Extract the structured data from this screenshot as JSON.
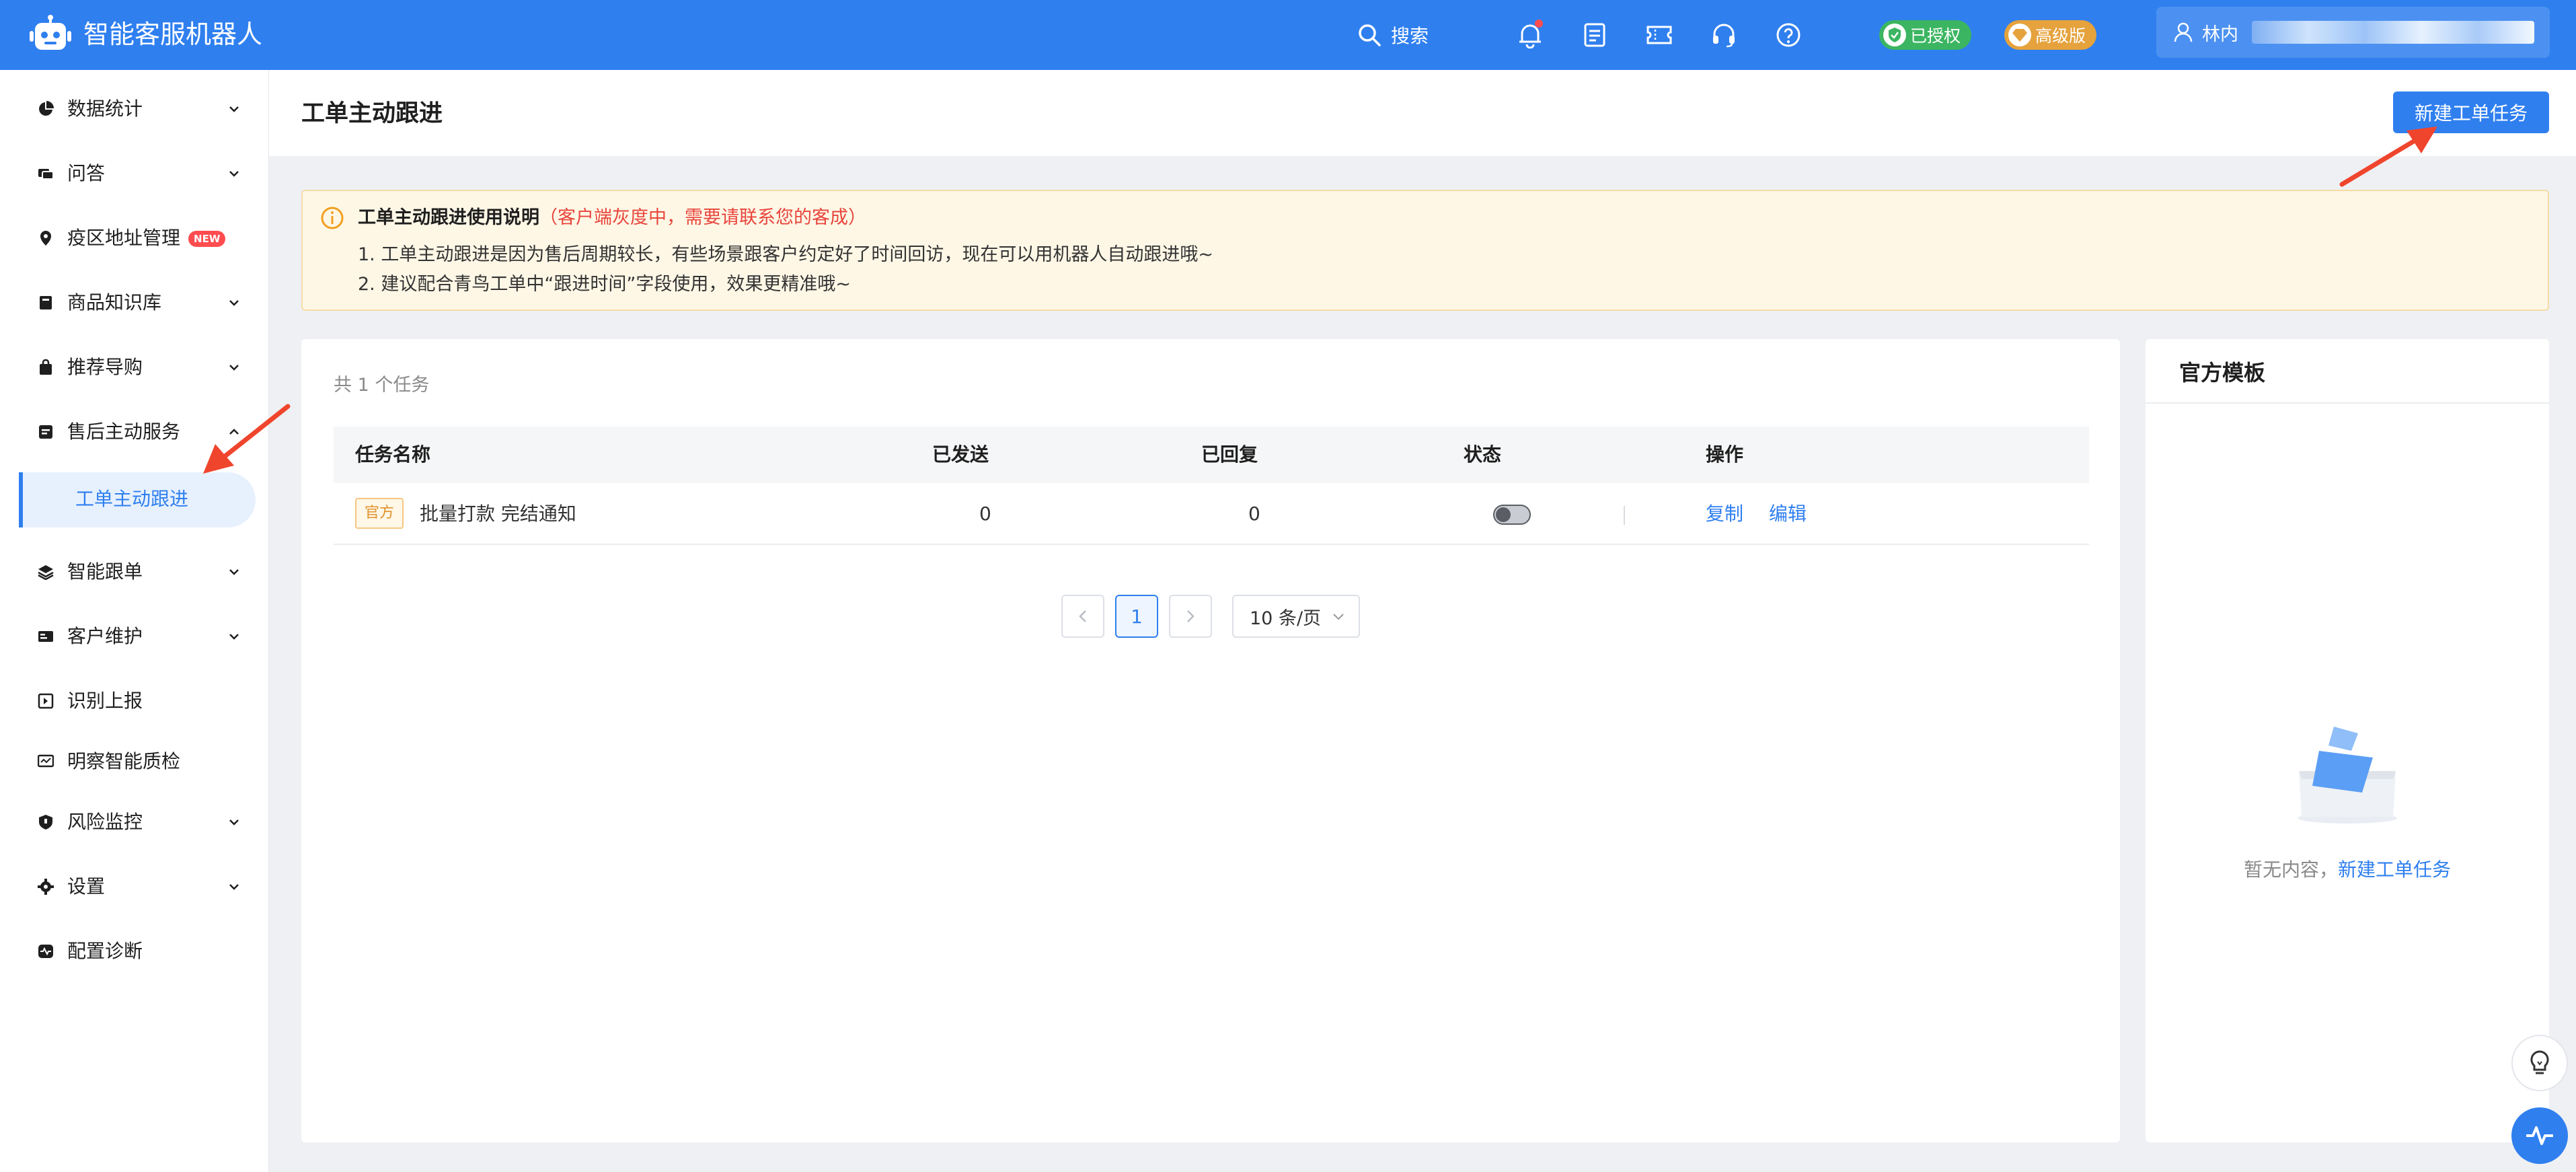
{
  "app": {
    "title": "智能客服机器人"
  },
  "header": {
    "search_label": "搜索",
    "authorized_label": "已授权",
    "edition_label": "高级版",
    "user_name": "林内"
  },
  "sidebar": {
    "items": [
      {
        "label": "数据统计",
        "icon": "pie-chart-icon"
      },
      {
        "label": "问答",
        "icon": "chat-icon"
      },
      {
        "label": "疫区地址管理",
        "icon": "location-icon",
        "badge": "NEW"
      },
      {
        "label": "商品知识库",
        "icon": "book-icon"
      },
      {
        "label": "推荐导购",
        "icon": "shopping-bag-icon"
      },
      {
        "label": "售后主动服务",
        "icon": "service-icon"
      },
      {
        "label": "智能跟单",
        "icon": "layers-icon"
      },
      {
        "label": "客户维护",
        "icon": "id-card-icon"
      },
      {
        "label": "识别上报",
        "icon": "report-icon"
      },
      {
        "label": "明察智能质检",
        "icon": "monitor-icon"
      },
      {
        "label": "风险监控",
        "icon": "shield-icon"
      },
      {
        "label": "设置",
        "icon": "gear-icon"
      },
      {
        "label": "配置诊断",
        "icon": "diagnose-icon"
      }
    ],
    "active_sub_item": "工单主动跟进"
  },
  "page": {
    "title": "工单主动跟进",
    "create_button": "新建工单任务"
  },
  "notice": {
    "title": "工单主动跟进使用说明",
    "warning": "（客户端灰度中，需要请联系您的客成）",
    "line1": "1. 工单主动跟进是因为售后周期较长，有些场景跟客户约定好了时间回访，现在可以用机器人自动跟进哦~",
    "line2": "2. 建议配合青鸟工单中“跟进时间”字段使用，效果更精准哦~"
  },
  "tasks": {
    "count_text": "共 1 个任务",
    "columns": [
      "任务名称",
      "已发送",
      "已回复",
      "状态",
      "操作"
    ],
    "rows": [
      {
        "tag": "官方",
        "name": "批量打款 完结通知",
        "sent": "0",
        "replied": "0",
        "enabled": false,
        "actions": [
          "复制",
          "编辑"
        ]
      }
    ],
    "pagination": {
      "current_page": "1",
      "page_size": "10 条/页"
    }
  },
  "templates": {
    "title": "官方模板",
    "empty_text": "暂无内容，",
    "empty_link": "新建工单任务"
  },
  "colors": {
    "primary": "#2f7fef",
    "warning": "#e8453c",
    "notice_bg": "#fef7e6",
    "annotation_arrow": "#f0452d"
  }
}
